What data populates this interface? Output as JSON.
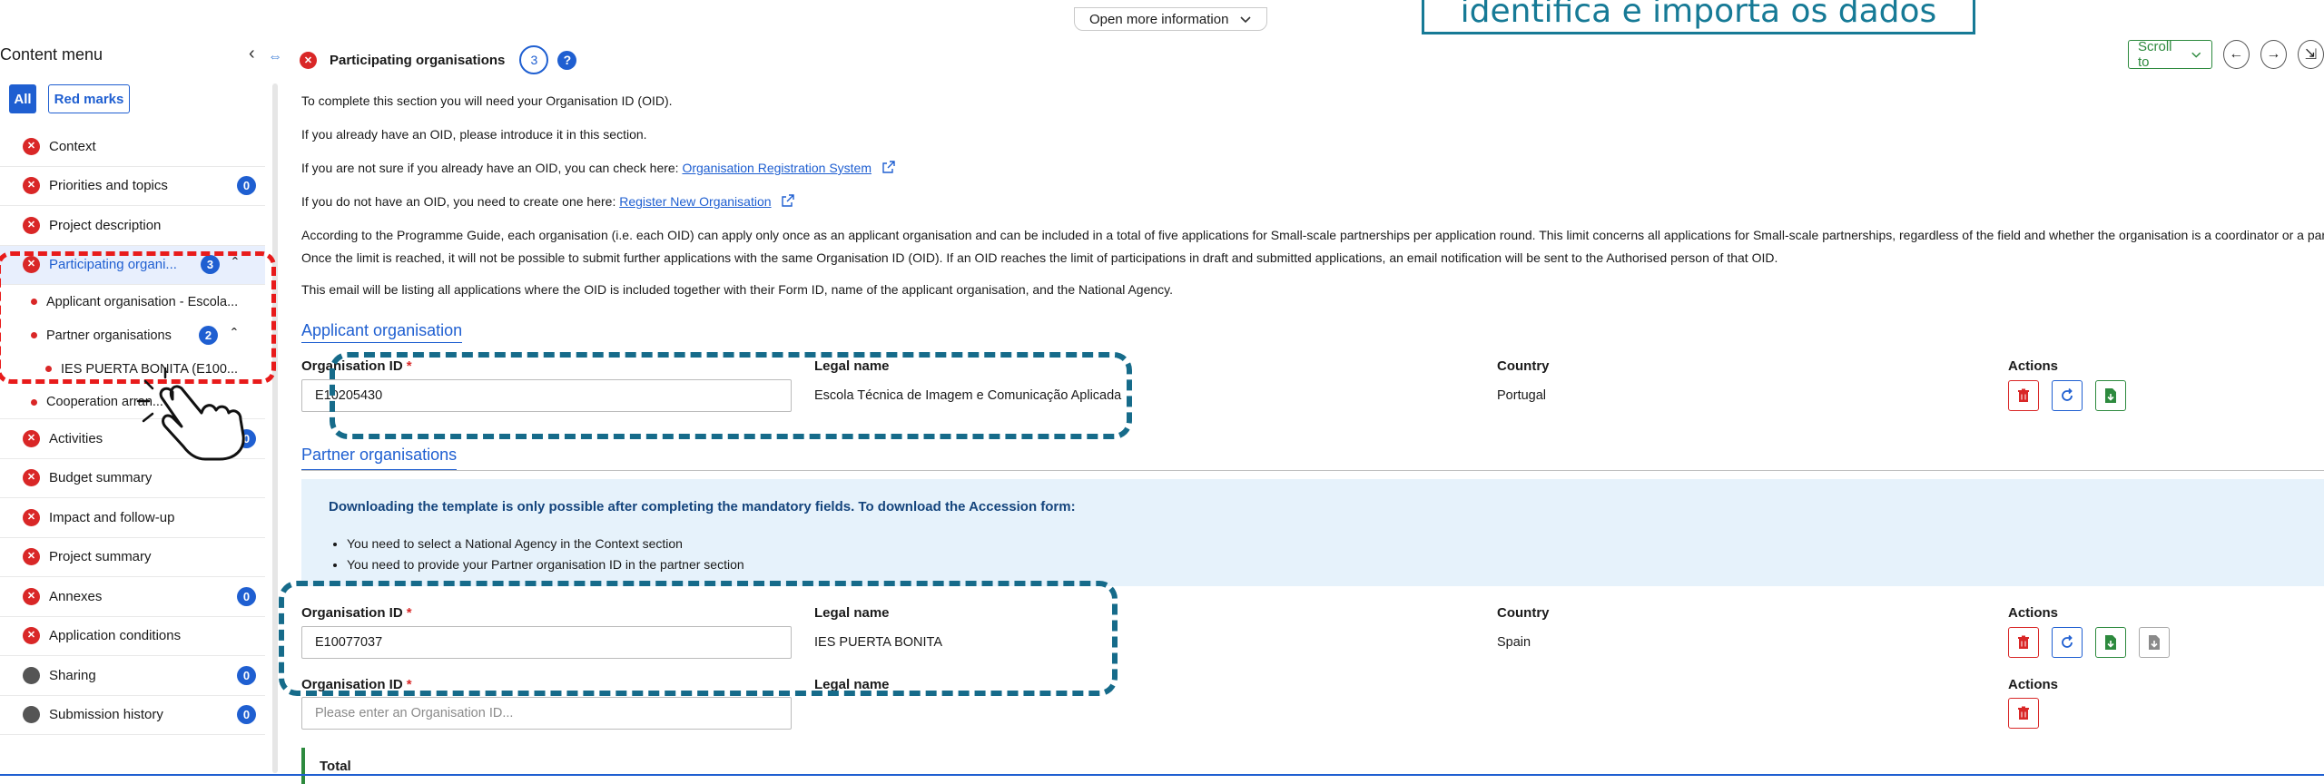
{
  "top": {
    "more_info_label": "Open more information",
    "callout_text": "identifica e importa os dados"
  },
  "sidebar": {
    "title": "Content menu",
    "filter_all": "All",
    "filter_red": "Red marks",
    "items": [
      {
        "label": "Context",
        "status": "error"
      },
      {
        "label": "Priorities and topics",
        "status": "error",
        "badge": "0"
      },
      {
        "label": "Project description",
        "status": "error"
      },
      {
        "label": "Participating organi...",
        "status": "error",
        "badge": "3"
      },
      {
        "label": "Applicant organisation - Escola..."
      },
      {
        "label": "Partner organisations",
        "badge": "2"
      },
      {
        "label": "IES PUERTA BONITA (E100..."
      },
      {
        "label": "Cooperation arran..."
      },
      {
        "label": "Activities",
        "status": "error",
        "badge": "0"
      },
      {
        "label": "Budget summary",
        "status": "error"
      },
      {
        "label": "Impact and follow-up",
        "status": "error"
      },
      {
        "label": "Project summary",
        "status": "error"
      },
      {
        "label": "Annexes",
        "status": "error",
        "badge": "0"
      },
      {
        "label": "Application conditions",
        "status": "error"
      },
      {
        "label": "Sharing",
        "status": "neutral",
        "badge": "0"
      },
      {
        "label": "Submission history",
        "status": "neutral",
        "badge": "0"
      }
    ]
  },
  "main": {
    "section_title": "Participating organisations",
    "section_count": "3",
    "help_label": "?",
    "scroll_to": "Scroll to",
    "intro": [
      "To complete this section you will need your Organisation ID (OID).",
      "If you already have an OID, please introduce it in this section."
    ],
    "check_text": "If you are not sure if you already have an OID, you can check here: ",
    "check_link": "Organisation Registration System",
    "create_text": "If you do not have an OID, you need to create one here: ",
    "create_link": "Register New Organisation",
    "guide_text": "According to the Programme Guide, each organisation (i.e. each OID) can apply only once as an applicant organisation and can be included in a total of five applications for Small-scale partnerships per application round. This limit concerns all applications for Small-scale partnerships, regardless of the field and whether the organisation is a coordinator or a partner. Once the limit is reached, it will not be possible to submit further applications with the same Organisation ID (OID). If an OID reaches the limit of participations in draft and submitted applications, an email notification will be sent to the Authorised person of that OID.",
    "email_text": "This email will be listing all applications where the OID is included together with their Form ID, name of the applicant organisation, and the National Agency.",
    "applicant": {
      "title": "Applicant organisation",
      "col_oid": "Organisation ID",
      "col_name": "Legal name",
      "col_country": "Country",
      "col_actions": "Actions",
      "oid": "E10205430",
      "name": "Escola Técnica de Imagem e Comunicação Aplicada",
      "country": "Portugal"
    },
    "partners": {
      "title": "Partner organisations",
      "band_title": "Downloading the template is only possible after completing the mandatory fields. To download the Accession form:",
      "band_items": [
        "You need to select a National Agency in the Context section",
        "You need to provide your Partner organisation ID in the partner section"
      ],
      "row1": {
        "col_oid": "Organisation ID",
        "col_name": "Legal name",
        "col_country": "Country",
        "col_actions": "Actions",
        "oid": "E10077037",
        "name": "IES PUERTA BONITA",
        "country": "Spain"
      },
      "row2": {
        "col_oid": "Organisation ID",
        "col_name": "Legal name",
        "col_actions": "Actions",
        "placeholder": "Please enter an Organisation ID..."
      }
    },
    "total_label": "Total"
  }
}
